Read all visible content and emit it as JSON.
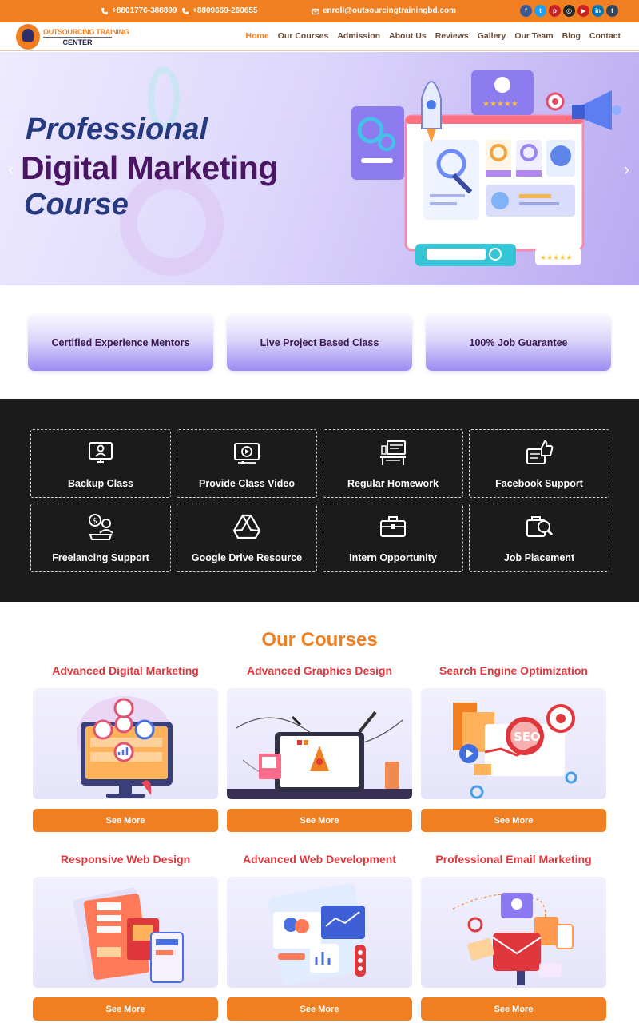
{
  "topbar": {
    "phone1": "+8801776-388899",
    "phone2": "+8809669-260655",
    "email": "enroll@outsourcingtrainingbd.com",
    "social": [
      {
        "name": "facebook-icon",
        "glyph": "f",
        "color": "#3b5998"
      },
      {
        "name": "twitter-icon",
        "glyph": "t",
        "color": "#1da1f2"
      },
      {
        "name": "pinterest-icon",
        "glyph": "p",
        "color": "#cb2027"
      },
      {
        "name": "instagram-icon",
        "glyph": "◎",
        "color": "#262626"
      },
      {
        "name": "youtube-icon",
        "glyph": "▶",
        "color": "#cd201f"
      },
      {
        "name": "linkedin-icon",
        "glyph": "in",
        "color": "#0077b5"
      },
      {
        "name": "tumblr-icon",
        "glyph": "t",
        "color": "#35465c"
      }
    ]
  },
  "header": {
    "logo_line1": "OUTSOURCING TRAINING",
    "logo_line2": "CENTER",
    "nav": [
      "Home",
      "Our Courses",
      "Admission",
      "About Us",
      "Reviews",
      "Gallery",
      "Our Team",
      "Blog",
      "Contact"
    ],
    "active_nav": "Home"
  },
  "hero": {
    "line1": "Professional",
    "line2": "Digital Marketing",
    "line3": "Course",
    "prev": "‹",
    "next": "›"
  },
  "features": [
    "Certified Experience Mentors",
    "Live Project Based Class",
    "100% Job Guarantee"
  ],
  "services": [
    {
      "label": "Backup Class",
      "icon": "monitor-user-icon"
    },
    {
      "label": "Provide Class Video",
      "icon": "video-play-icon"
    },
    {
      "label": "Regular Homework",
      "icon": "homework-desk-icon"
    },
    {
      "label": "Facebook Support",
      "icon": "thumbs-up-chat-icon"
    },
    {
      "label": "Freelancing Support",
      "icon": "freelancer-dollar-icon"
    },
    {
      "label": "Google Drive Resource",
      "icon": "google-drive-icon"
    },
    {
      "label": "Intern Opportunity",
      "icon": "briefcase-icon"
    },
    {
      "label": "Job Placement",
      "icon": "job-search-icon"
    }
  ],
  "courses": {
    "title": "Our Courses",
    "button_label": "See More",
    "items": [
      {
        "title": "Advanced Digital Marketing"
      },
      {
        "title": "Advanced Graphics Design"
      },
      {
        "title": "Search Engine Optimization"
      },
      {
        "title": "Responsive Web Design"
      },
      {
        "title": "Advanced Web Development"
      },
      {
        "title": "Professional Email Marketing"
      }
    ],
    "seo_badge": "SEO"
  },
  "colors": {
    "accent": "#f07f22",
    "course_title": "#e0373d",
    "dark_bg": "#1b1b1b"
  }
}
